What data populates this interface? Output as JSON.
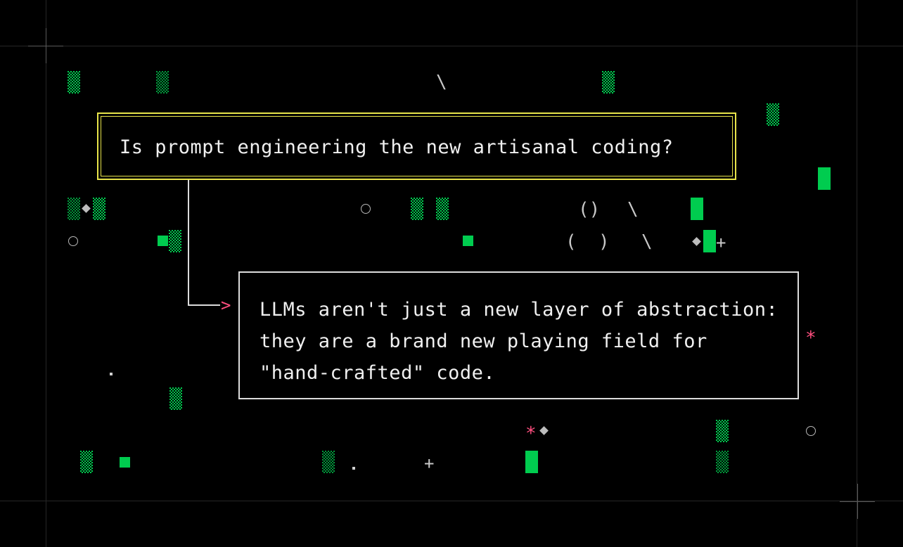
{
  "question": "Is prompt engineering the new artisanal coding?",
  "answer": "LLMs aren't just a new layer of abstraction: they are a brand new playing field for \"hand-crafted\" code.",
  "decor": {
    "backslash": "\\",
    "paren_pair": "()",
    "paren_spaced": "(  )",
    "plus": "+",
    "asterisk": "*",
    "arrow": ">"
  },
  "colors": {
    "background": "#000000",
    "accent_green": "#00cc4f",
    "accent_yellow": "#e8e44a",
    "accent_pink": "#ff4f7f",
    "text": "#f0f0f0"
  }
}
